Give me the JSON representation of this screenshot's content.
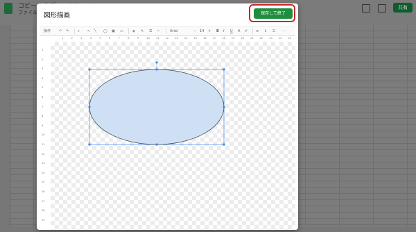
{
  "background_app": {
    "title": "コピーのスプレッドシート",
    "menu_first": "ファイル",
    "share_label": "共有"
  },
  "dialog": {
    "title": "図形描画",
    "save_close_label": "保存して終了",
    "toolbar": {
      "actions_label": "操作",
      "font": "Arial",
      "font_size": "14",
      "bold": "B",
      "italic": "I",
      "underline": "U",
      "text_color": "A"
    },
    "ruler_top": [
      "1",
      "2",
      "3",
      "4",
      "5",
      "6",
      "7",
      "8",
      "9",
      "10",
      "11",
      "12",
      "13",
      "14",
      "15",
      "16",
      "17",
      "18",
      "19",
      "20",
      "21",
      "22",
      "23",
      "24",
      "25"
    ],
    "ruler_left": [
      "1",
      "2",
      "3",
      "4",
      "5",
      "6",
      "7",
      "8",
      "9",
      "10",
      "11",
      "12",
      "13",
      "14",
      "15",
      "16",
      "17",
      "18",
      "19"
    ],
    "shape": {
      "type": "ellipse",
      "fill": "#cfe0f4",
      "stroke": "#3c4a5c",
      "selection_color": "#4285f4"
    }
  }
}
